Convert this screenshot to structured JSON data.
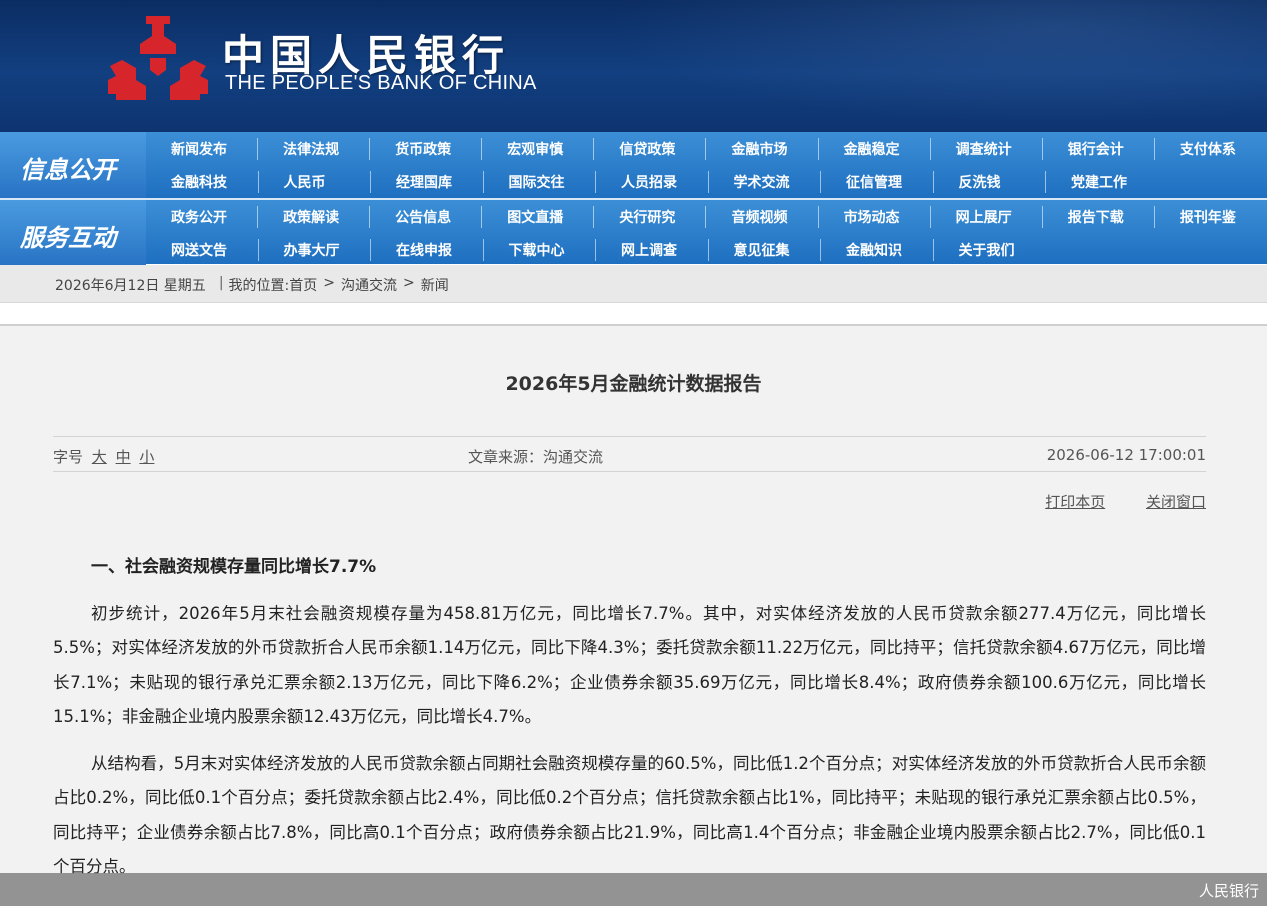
{
  "header": {
    "logo_cn": "中国人民银行",
    "logo_en": "THE PEOPLE'S BANK OF CHINA",
    "emblem_color": "#d7262b"
  },
  "nav": {
    "section1_label": "信息公开",
    "section1_row1": [
      "新闻发布",
      "法律法规",
      "货币政策",
      "宏观审慎",
      "信贷政策",
      "金融市场",
      "金融稳定",
      "调查统计",
      "银行会计",
      "支付体系"
    ],
    "section1_row2": [
      "金融科技",
      "人民币",
      "经理国库",
      "国际交往",
      "人员招录",
      "学术交流",
      "征信管理",
      "反洗钱",
      "党建工作"
    ],
    "section2_label": "服务互动",
    "section2_row1": [
      "政务公开",
      "政策解读",
      "公告信息",
      "图文直播",
      "央行研究",
      "音频视频",
      "市场动态",
      "网上展厅",
      "报告下载",
      "报刊年鉴"
    ],
    "section2_row2": [
      "网送文告",
      "办事大厅",
      "在线申报",
      "下载中心",
      "网上调查",
      "意见征集",
      "金融知识",
      "关于我们"
    ]
  },
  "breadcrumb": {
    "date": "2026年6月12日 星期五",
    "sep": "|",
    "prefix": "我的位置:",
    "home": "首页",
    "arrow": ">",
    "level1": "沟通交流",
    "level2": "新闻"
  },
  "article": {
    "title": "2026年5月金融统计数据报告",
    "font_size_label": "字号",
    "font_large": "大",
    "font_medium": "中",
    "font_small": "小",
    "source": "文章来源：沟通交流",
    "datetime": "2026-06-12 17:00:01",
    "print": "打印本页",
    "close": "关闭窗口",
    "heading1": "一、社会融资规模存量同比增长7.7%",
    "para1": "初步统计，2026年5月末社会融资规模存量为458.81万亿元，同比增长7.7%。其中，对实体经济发放的人民币贷款余额277.4万亿元，同比增长5.5%；对实体经济发放的外币贷款折合人民币余额1.14万亿元，同比下降4.3%；委托贷款余额11.22万亿元，同比持平；信托贷款余额4.67万亿元，同比增长7.1%；未贴现的银行承兑汇票余额2.13万亿元，同比下降6.2%；企业债券余额35.69万亿元，同比增长8.4%；政府债券余额100.6万亿元，同比增长15.1%；非金融企业境内股票余额12.43万亿元，同比增长4.7%。",
    "para2": "从结构看，5月末对实体经济发放的人民币贷款余额占同期社会融资规模存量的60.5%，同比低1.2个百分点；对实体经济发放的外币贷款折合人民币余额占比0.2%，同比低0.1个百分点；委托贷款余额占比2.4%，同比低0.2个百分点；信托贷款余额占比1%，同比持平；未贴现的银行承兑汇票余额占比0.5%，同比持平；企业债券余额占比7.8%，同比高0.1个百分点；政府债券余额占比21.9%，同比高1.4个百分点；非金融企业境内股票余额占比2.7%，同比低0.1个百分点。"
  },
  "footer": {
    "watermark": "人民银行"
  }
}
